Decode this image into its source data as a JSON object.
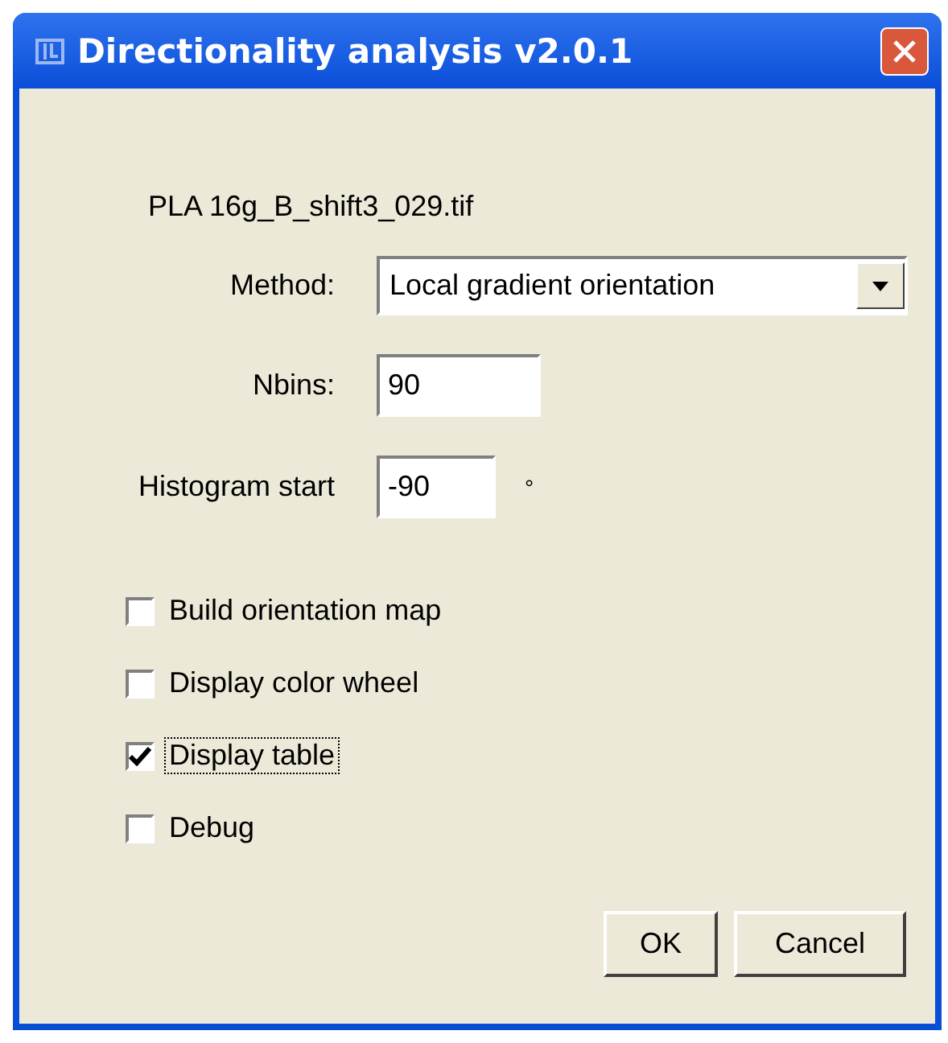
{
  "window": {
    "title": "Directionality analysis v2.0.1"
  },
  "file_name": "PLA 16g_B_shift3_029.tif",
  "fields": [
    {
      "kind": "dropdown",
      "label": "Method:",
      "value": "Local gradient orientation"
    },
    {
      "kind": "text",
      "label": "Nbins:",
      "value": "90"
    },
    {
      "kind": "short",
      "label": "Histogram start",
      "value": "-90",
      "unit": "°"
    }
  ],
  "checkboxes": [
    {
      "label": "Build orientation map",
      "checked": false,
      "focused": false
    },
    {
      "label": "Display color wheel",
      "checked": false,
      "focused": false
    },
    {
      "label": "Display table",
      "checked": true,
      "focused": true
    },
    {
      "label": "Debug",
      "checked": false,
      "focused": false
    }
  ],
  "buttons": [
    "OK",
    "Cancel"
  ]
}
